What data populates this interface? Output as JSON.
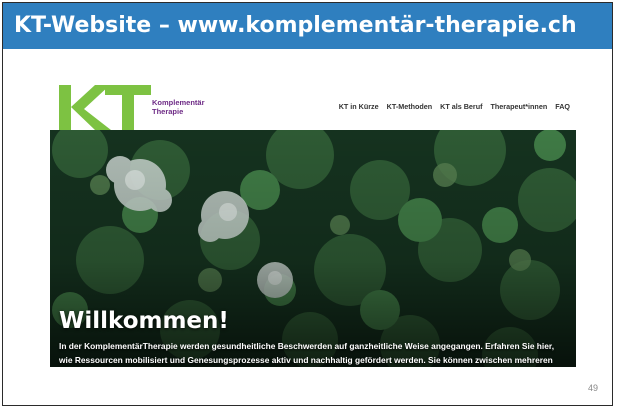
{
  "slide": {
    "title": "KT-Website – www.komplementär-therapie.ch",
    "page_number": "49"
  },
  "site": {
    "logo_text": "KT",
    "brand_line1": "Komplementär",
    "brand_line2": "Therapie",
    "nav": [
      "KT in Kürze",
      "KT-Methoden",
      "KT als Beruf",
      "Therapeut*innen",
      "FAQ"
    ],
    "hero": {
      "heading": "Willkommen!",
      "text": "In der KomplementärTherapie werden gesundheitliche Beschwerden auf ganzheitliche Weise angegangen. Erfahren Sie hier, wie Ressourcen mobilisiert und Genesungsprozesse aktiv und nachhaltig gefördert werden. Sie können zwischen mehreren Methoden mit unterschiedlichen Ansätzen wählen."
    }
  },
  "colors": {
    "title_bar": "#2f7fbf",
    "logo_green": "#7dc242",
    "brand_purple": "#6e2b86"
  }
}
